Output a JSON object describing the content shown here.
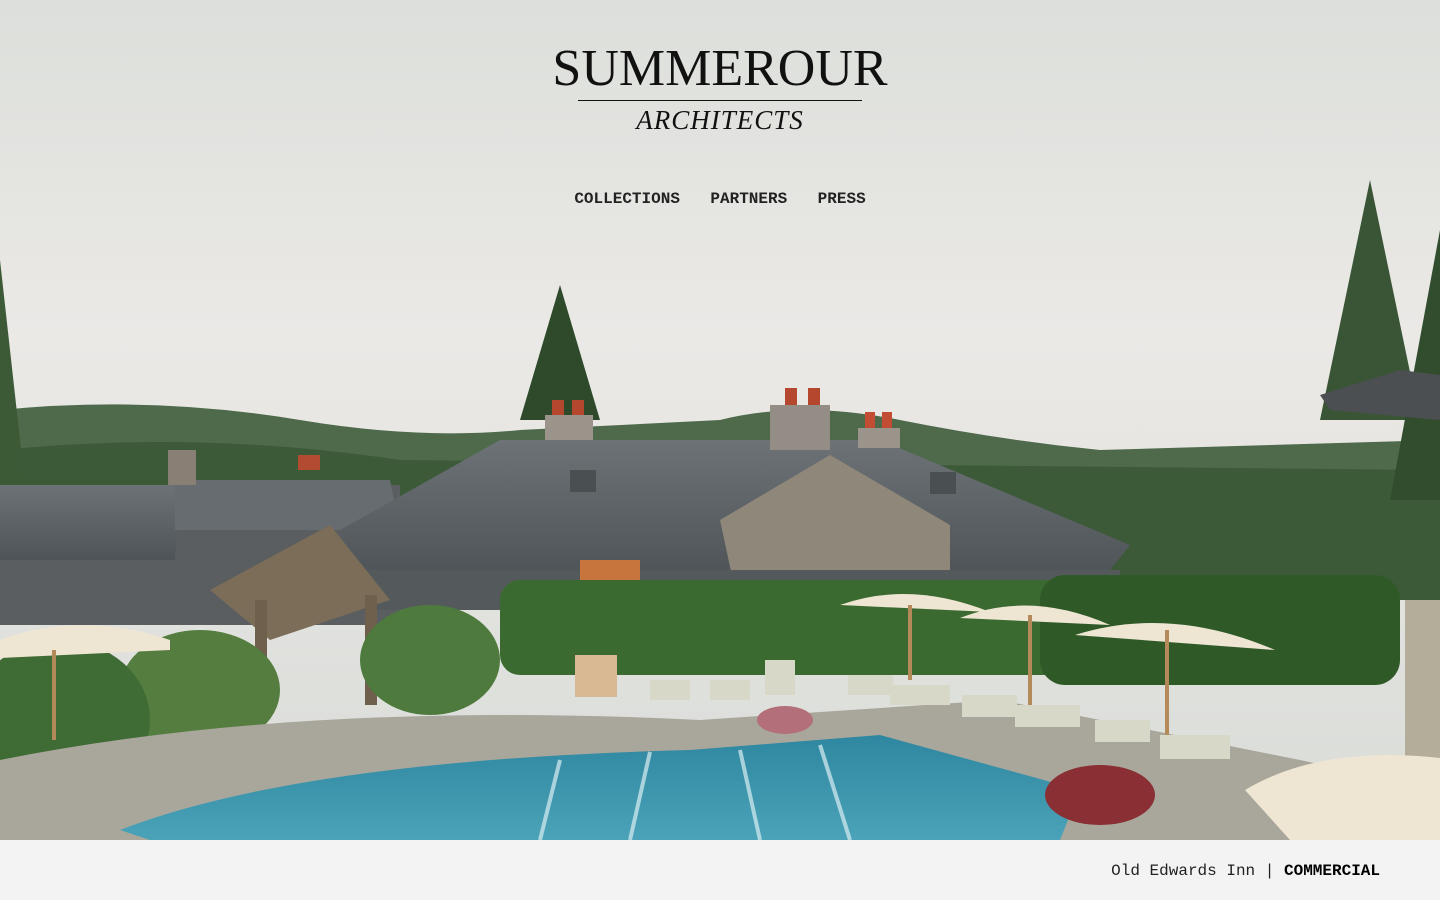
{
  "logo": {
    "main": "SUMMEROUR",
    "sub": "ARCHITECTS"
  },
  "nav": {
    "items": [
      {
        "label": "COLLECTIONS"
      },
      {
        "label": "PARTNERS"
      },
      {
        "label": "PRESS"
      }
    ]
  },
  "hero": {
    "description_icon": "photo-old-edwards-inn-pool"
  },
  "caption": {
    "project": "Old Edwards Inn",
    "separator": "|",
    "category": "COMMERCIAL"
  },
  "colors": {
    "sky": "#e9eae6",
    "hills": "#3f5a3c",
    "roof": "#5e6468",
    "pool": "#3f8fa6",
    "deck": "#a7a59a",
    "hedge": "#2f5a2c",
    "umbrella": "#efe6d6",
    "footer_bg": "#f3f3f3"
  }
}
